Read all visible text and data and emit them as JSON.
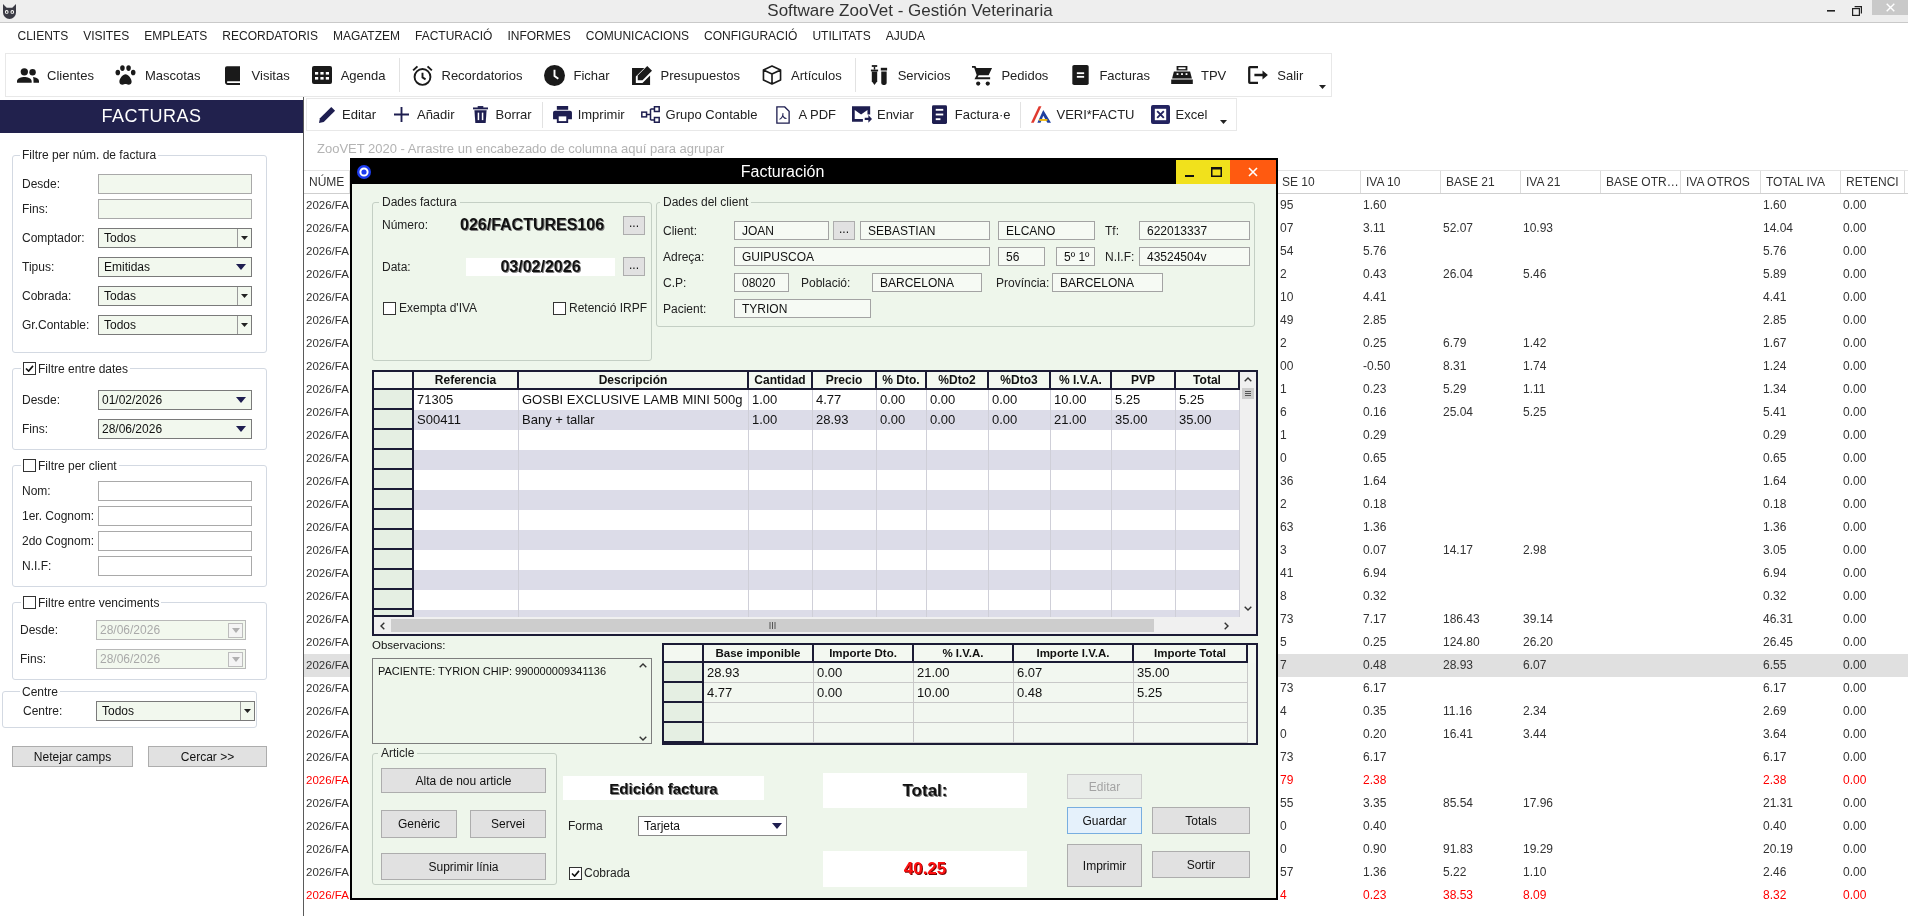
{
  "window": {
    "title": "Software ZooVet - Gestión Veterinaria"
  },
  "menu": [
    "CLIENTS",
    "VISITES",
    "EMPLEATS",
    "RECORDATORIS",
    "MAGATZEM",
    "FACTURACIÓ",
    "INFORMES",
    "COMUNICACIONS",
    "CONFIGURACIÓ",
    "UTILITATS",
    "AJUDA"
  ],
  "main_toolbar": {
    "groups": [
      [
        "Clientes",
        "Mascotas",
        "Visitas",
        "Agenda"
      ],
      [
        "Recordatorios",
        "Fichar",
        "Presupuestos",
        "Artículos"
      ],
      [
        "Servicios",
        "Pedidos",
        "Facturas",
        "TPV",
        "Salir"
      ]
    ]
  },
  "sidebar": {
    "title": "FACTURAS",
    "groups": [
      {
        "kind": "plain",
        "title": "Filtre per núm. de factura",
        "fields": [
          {
            "label": "Desde:",
            "kind": "text",
            "disabled": false
          },
          {
            "label": "Fins:",
            "kind": "text",
            "disabled": false
          },
          {
            "label": "Comptador:",
            "kind": "combo",
            "value": "Todos",
            "disabled": false
          },
          {
            "label": "Tipus:",
            "kind": "dropdown",
            "value": "Emitidas",
            "disabled": false
          },
          {
            "label": "Cobrada:",
            "kind": "combo",
            "value": "Todas",
            "disabled": false
          },
          {
            "label": "Gr.Contable:",
            "kind": "combo",
            "value": "Todos",
            "disabled": false
          }
        ]
      },
      {
        "kind": "checkable",
        "title": "Filtre entre dates",
        "checked": true,
        "fields": [
          {
            "label": "Desde:",
            "kind": "date",
            "value": "01/02/2026",
            "disabled": false
          },
          {
            "label": "Fins:",
            "kind": "date",
            "value": "28/06/2026",
            "disabled": false
          }
        ]
      },
      {
        "kind": "checkable",
        "title": "Filtre per client",
        "checked": false,
        "fields": [
          {
            "label": "Nom:",
            "kind": "text",
            "disabled": false
          },
          {
            "label": "1er. Cognom:",
            "kind": "text",
            "disabled": false
          },
          {
            "label": "2do Cognom:",
            "kind": "text",
            "disabled": false
          },
          {
            "label": "N.I.F:",
            "kind": "text",
            "disabled": false
          }
        ]
      },
      {
        "kind": "checkable",
        "title": "Filtre entre venciments",
        "checked": false,
        "fields": [
          {
            "label": "Desde:",
            "kind": "date",
            "value": "28/06/2026",
            "disabled": true
          },
          {
            "label": "Fins:",
            "kind": "date",
            "value": "28/06/2026",
            "disabled": true
          }
        ]
      },
      {
        "kind": "plain",
        "title": "Centre",
        "fields": [
          {
            "label": "Centre:",
            "kind": "combo",
            "value": "Todos",
            "disabled": false
          }
        ]
      }
    ],
    "buttons": [
      "Netejar camps",
      "Cercar >>"
    ]
  },
  "list_toolbar": {
    "groups": [
      [
        "Editar",
        "Añadir",
        "Borrar"
      ],
      [
        "Imprimir",
        "Grupo Contable",
        "A PDF",
        "Enviar",
        "Factura·e"
      ],
      [
        "VERI*FACTU",
        "Excel"
      ]
    ]
  },
  "invoice_list": {
    "group_hint": "ZooVET 2020 - Arrastre un encabezado de columna aquí para agrupar",
    "columns": [
      "NÚME",
      "SE 10",
      "IVA 10",
      "BASE 21",
      "IVA 21",
      "BASE OTR…",
      "IVA OTROS",
      "TOTAL IVA",
      "RETENCI"
    ],
    "rows": [
      {
        "number": "2026/FA",
        "base_10": "95",
        "iva_10": "1.60",
        "total_iva": "1.60",
        "retention": "0.00",
        "selected": false,
        "color": "#333333"
      },
      {
        "number": "2026/FA",
        "base_10": "07",
        "iva_10": "3.11",
        "base_21": "52.07",
        "iva_21": "10.93",
        "total_iva": "14.04",
        "retention": "0.00",
        "selected": false,
        "color": "#333333"
      },
      {
        "number": "2026/FA",
        "base_10": "54",
        "iva_10": "5.76",
        "total_iva": "5.76",
        "retention": "0.00",
        "selected": false,
        "color": "#333333"
      },
      {
        "number": "2026/FA",
        "base_10": "2",
        "iva_10": "0.43",
        "base_21": "26.04",
        "iva_21": "5.46",
        "total_iva": "5.89",
        "retention": "0.00",
        "selected": false,
        "color": "#333333"
      },
      {
        "number": "2026/FA",
        "base_10": "10",
        "iva_10": "4.41",
        "total_iva": "4.41",
        "retention": "0.00",
        "selected": false,
        "color": "#333333"
      },
      {
        "number": "2026/FA",
        "base_10": "49",
        "iva_10": "2.85",
        "total_iva": "2.85",
        "retention": "0.00",
        "selected": false,
        "color": "#333333"
      },
      {
        "number": "2026/FA",
        "base_10": "2",
        "iva_10": "0.25",
        "base_21": "6.79",
        "iva_21": "1.42",
        "total_iva": "1.67",
        "retention": "0.00",
        "selected": false,
        "color": "#333333"
      },
      {
        "number": "2026/FA",
        "base_10": "00",
        "iva_10": "-0.50",
        "base_21": "8.31",
        "iva_21": "1.74",
        "total_iva": "1.24",
        "retention": "0.00",
        "selected": false,
        "color": "#333333"
      },
      {
        "number": "2026/FA",
        "base_10": "1",
        "iva_10": "0.23",
        "base_21": "5.29",
        "iva_21": "1.11",
        "total_iva": "1.34",
        "retention": "0.00",
        "selected": false,
        "color": "#333333"
      },
      {
        "number": "2026/FA",
        "base_10": "6",
        "iva_10": "0.16",
        "base_21": "25.04",
        "iva_21": "5.25",
        "total_iva": "5.41",
        "retention": "0.00",
        "selected": false,
        "color": "#333333"
      },
      {
        "number": "2026/FA",
        "base_10": "1",
        "iva_10": "0.29",
        "total_iva": "0.29",
        "retention": "0.00",
        "selected": false,
        "color": "#333333"
      },
      {
        "number": "2026/FA",
        "base_10": "0",
        "iva_10": "0.65",
        "total_iva": "0.65",
        "retention": "0.00",
        "selected": false,
        "color": "#333333"
      },
      {
        "number": "2026/FA",
        "base_10": "36",
        "iva_10": "1.64",
        "total_iva": "1.64",
        "retention": "0.00",
        "selected": false,
        "color": "#333333"
      },
      {
        "number": "2026/FA",
        "base_10": "2",
        "iva_10": "0.18",
        "total_iva": "0.18",
        "retention": "0.00",
        "selected": false,
        "color": "#333333"
      },
      {
        "number": "2026/FA",
        "base_10": "63",
        "iva_10": "1.36",
        "total_iva": "1.36",
        "retention": "0.00",
        "selected": false,
        "color": "#333333"
      },
      {
        "number": "2026/FA",
        "base_10": "3",
        "iva_10": "0.07",
        "base_21": "14.17",
        "iva_21": "2.98",
        "total_iva": "3.05",
        "retention": "0.00",
        "selected": false,
        "color": "#333333"
      },
      {
        "number": "2026/FA",
        "base_10": "41",
        "iva_10": "6.94",
        "total_iva": "6.94",
        "retention": "0.00",
        "selected": false,
        "color": "#333333"
      },
      {
        "number": "2026/FA",
        "base_10": "8",
        "iva_10": "0.32",
        "total_iva": "0.32",
        "retention": "0.00",
        "selected": false,
        "color": "#333333"
      },
      {
        "number": "2026/FA",
        "base_10": "73",
        "iva_10": "7.17",
        "base_21": "186.43",
        "iva_21": "39.14",
        "total_iva": "46.31",
        "retention": "0.00",
        "selected": false,
        "color": "#333333"
      },
      {
        "number": "2026/FA",
        "base_10": "5",
        "iva_10": "0.25",
        "base_21": "124.80",
        "iva_21": "26.20",
        "total_iva": "26.45",
        "retention": "0.00",
        "selected": false,
        "color": "#333333"
      },
      {
        "number": "2026/FA",
        "base_10": "7",
        "iva_10": "0.48",
        "base_21": "28.93",
        "iva_21": "6.07",
        "total_iva": "6.55",
        "retention": "0.00",
        "selected": true,
        "color": "#333333"
      },
      {
        "number": "2026/FA",
        "base_10": "73",
        "iva_10": "6.17",
        "total_iva": "6.17",
        "retention": "0.00",
        "selected": false,
        "color": "#333333"
      },
      {
        "number": "2026/FA",
        "base_10": "4",
        "iva_10": "0.35",
        "base_21": "11.16",
        "iva_21": "2.34",
        "total_iva": "2.69",
        "retention": "0.00",
        "selected": false,
        "color": "#333333"
      },
      {
        "number": "2026/FA",
        "base_10": "0",
        "iva_10": "0.20",
        "base_21": "16.41",
        "iva_21": "3.44",
        "total_iva": "3.64",
        "retention": "0.00",
        "selected": false,
        "color": "#333333"
      },
      {
        "number": "2026/FA",
        "base_10": "73",
        "iva_10": "6.17",
        "total_iva": "6.17",
        "retention": "0.00",
        "selected": false,
        "color": "#333333"
      },
      {
        "number": "2026/FA",
        "base_10": "79",
        "iva_10": "2.38",
        "total_iva": "2.38",
        "retention": "0.00",
        "selected": false,
        "color": "#ff0000"
      },
      {
        "number": "2026/FA",
        "base_10": "55",
        "iva_10": "3.35",
        "base_21": "85.54",
        "iva_21": "17.96",
        "total_iva": "21.31",
        "retention": "0.00",
        "selected": false,
        "color": "#333333"
      },
      {
        "number": "2026/FA",
        "base_10": "0",
        "iva_10": "0.40",
        "total_iva": "0.40",
        "retention": "0.00",
        "selected": false,
        "color": "#333333"
      },
      {
        "number": "2026/FA",
        "base_10": "0",
        "iva_10": "0.90",
        "base_21": "91.83",
        "iva_21": "19.29",
        "total_iva": "20.19",
        "retention": "0.00",
        "selected": false,
        "color": "#333333"
      },
      {
        "number": "2026/FA",
        "base_10": "57",
        "iva_10": "1.36",
        "base_21": "5.22",
        "iva_21": "1.10",
        "total_iva": "2.46",
        "retention": "0.00",
        "selected": false,
        "color": "#333333"
      },
      {
        "number": "2026/FA",
        "base_10": "4",
        "iva_10": "0.23",
        "base_21": "38.53",
        "iva_21": "8.09",
        "total_iva": "8.32",
        "retention": "0.00",
        "selected": false,
        "color": "#ff0000"
      }
    ]
  },
  "invoice_dialog": {
    "title": "Facturación",
    "invoice_data": {
      "title": "Dades factura",
      "number": {
        "label": "Número:",
        "value": "026/FACTURES106",
        "button": "..."
      },
      "date": {
        "label": "Data:",
        "value": "03/02/2026",
        "button": "..."
      },
      "checkboxes": [
        {
          "label": "Exempta d'IVA",
          "checked": false
        },
        {
          "label": "Retenció IRPF",
          "checked": false
        }
      ]
    },
    "client": {
      "title": "Dades del client",
      "name": {
        "label": "Client:",
        "first_name": "JOAN",
        "button": "...",
        "surname_1": "SEBASTIAN",
        "surname_2": "ELCANO"
      },
      "phone": {
        "label": "Tf:",
        "value": "622013337"
      },
      "address": {
        "label": "Adreça:",
        "street": "GUIPUSCOA",
        "number": "56",
        "floor": "5º 1º"
      },
      "tax_id": {
        "label": "N.I.F:",
        "value": "43524504v"
      },
      "postcode": {
        "label": "C.P:",
        "value": "08020"
      },
      "town": {
        "label": "Població:",
        "value": "BARCELONA"
      },
      "province": {
        "label": "Província:",
        "value": "BARCELONA"
      },
      "patient": {
        "label": "Pacient:",
        "value": "TYRION"
      }
    },
    "lines": {
      "columns": [
        "Referencia",
        "Descripción",
        "Cantidad",
        "Precio",
        "% Dto.",
        "%Dto2",
        "%Dto3",
        "% I.V.A.",
        "PVP",
        "Total"
      ],
      "rows": [
        [
          "71305",
          "GOSBI EXCLUSIVE LAMB MINI 500g",
          "1.00",
          "4.77",
          "0.00",
          "0.00",
          "0.00",
          "10.00",
          "5.25",
          "5.25"
        ],
        [
          "S00411",
          "Bany + tallar",
          "1.00",
          "28.93",
          "0.00",
          "0.00",
          "0.00",
          "21.00",
          "35.00",
          "35.00"
        ]
      ]
    },
    "observations": {
      "label": "Observacions:",
      "value": "PACIENTE: TYRION CHIP: 990000009341136"
    },
    "vat_summary": {
      "columns": [
        "Base imponible",
        "Importe Dto.",
        "% I.V.A.",
        "Importe I.V.A.",
        "Importe Total"
      ],
      "rows": [
        [
          "28.93",
          "0.00",
          "21.00",
          "6.07",
          "35.00"
        ],
        [
          "4.77",
          "0.00",
          "10.00",
          "0.48",
          "5.25"
        ]
      ]
    },
    "article": {
      "title": "Article",
      "buttons": [
        "Alta de nou article",
        "Genèric",
        "Servei",
        "Suprimir línia"
      ]
    },
    "mode": "Edición factura",
    "payment": {
      "label": "Forma",
      "value": "Tarjeta"
    },
    "paid": {
      "label": "Cobrada",
      "checked": true
    },
    "total": {
      "label": "Total:",
      "value": "40.25"
    },
    "buttons": [
      {
        "label": "Editar",
        "disabled": true,
        "focused": false
      },
      {
        "label": "Guardar",
        "disabled": false,
        "focused": true
      },
      {
        "label": "Totals",
        "disabled": false,
        "focused": false
      },
      {
        "label": "Imprimir",
        "disabled": false,
        "focused": false
      },
      {
        "label": "Sortir",
        "disabled": false,
        "focused": false
      }
    ]
  }
}
